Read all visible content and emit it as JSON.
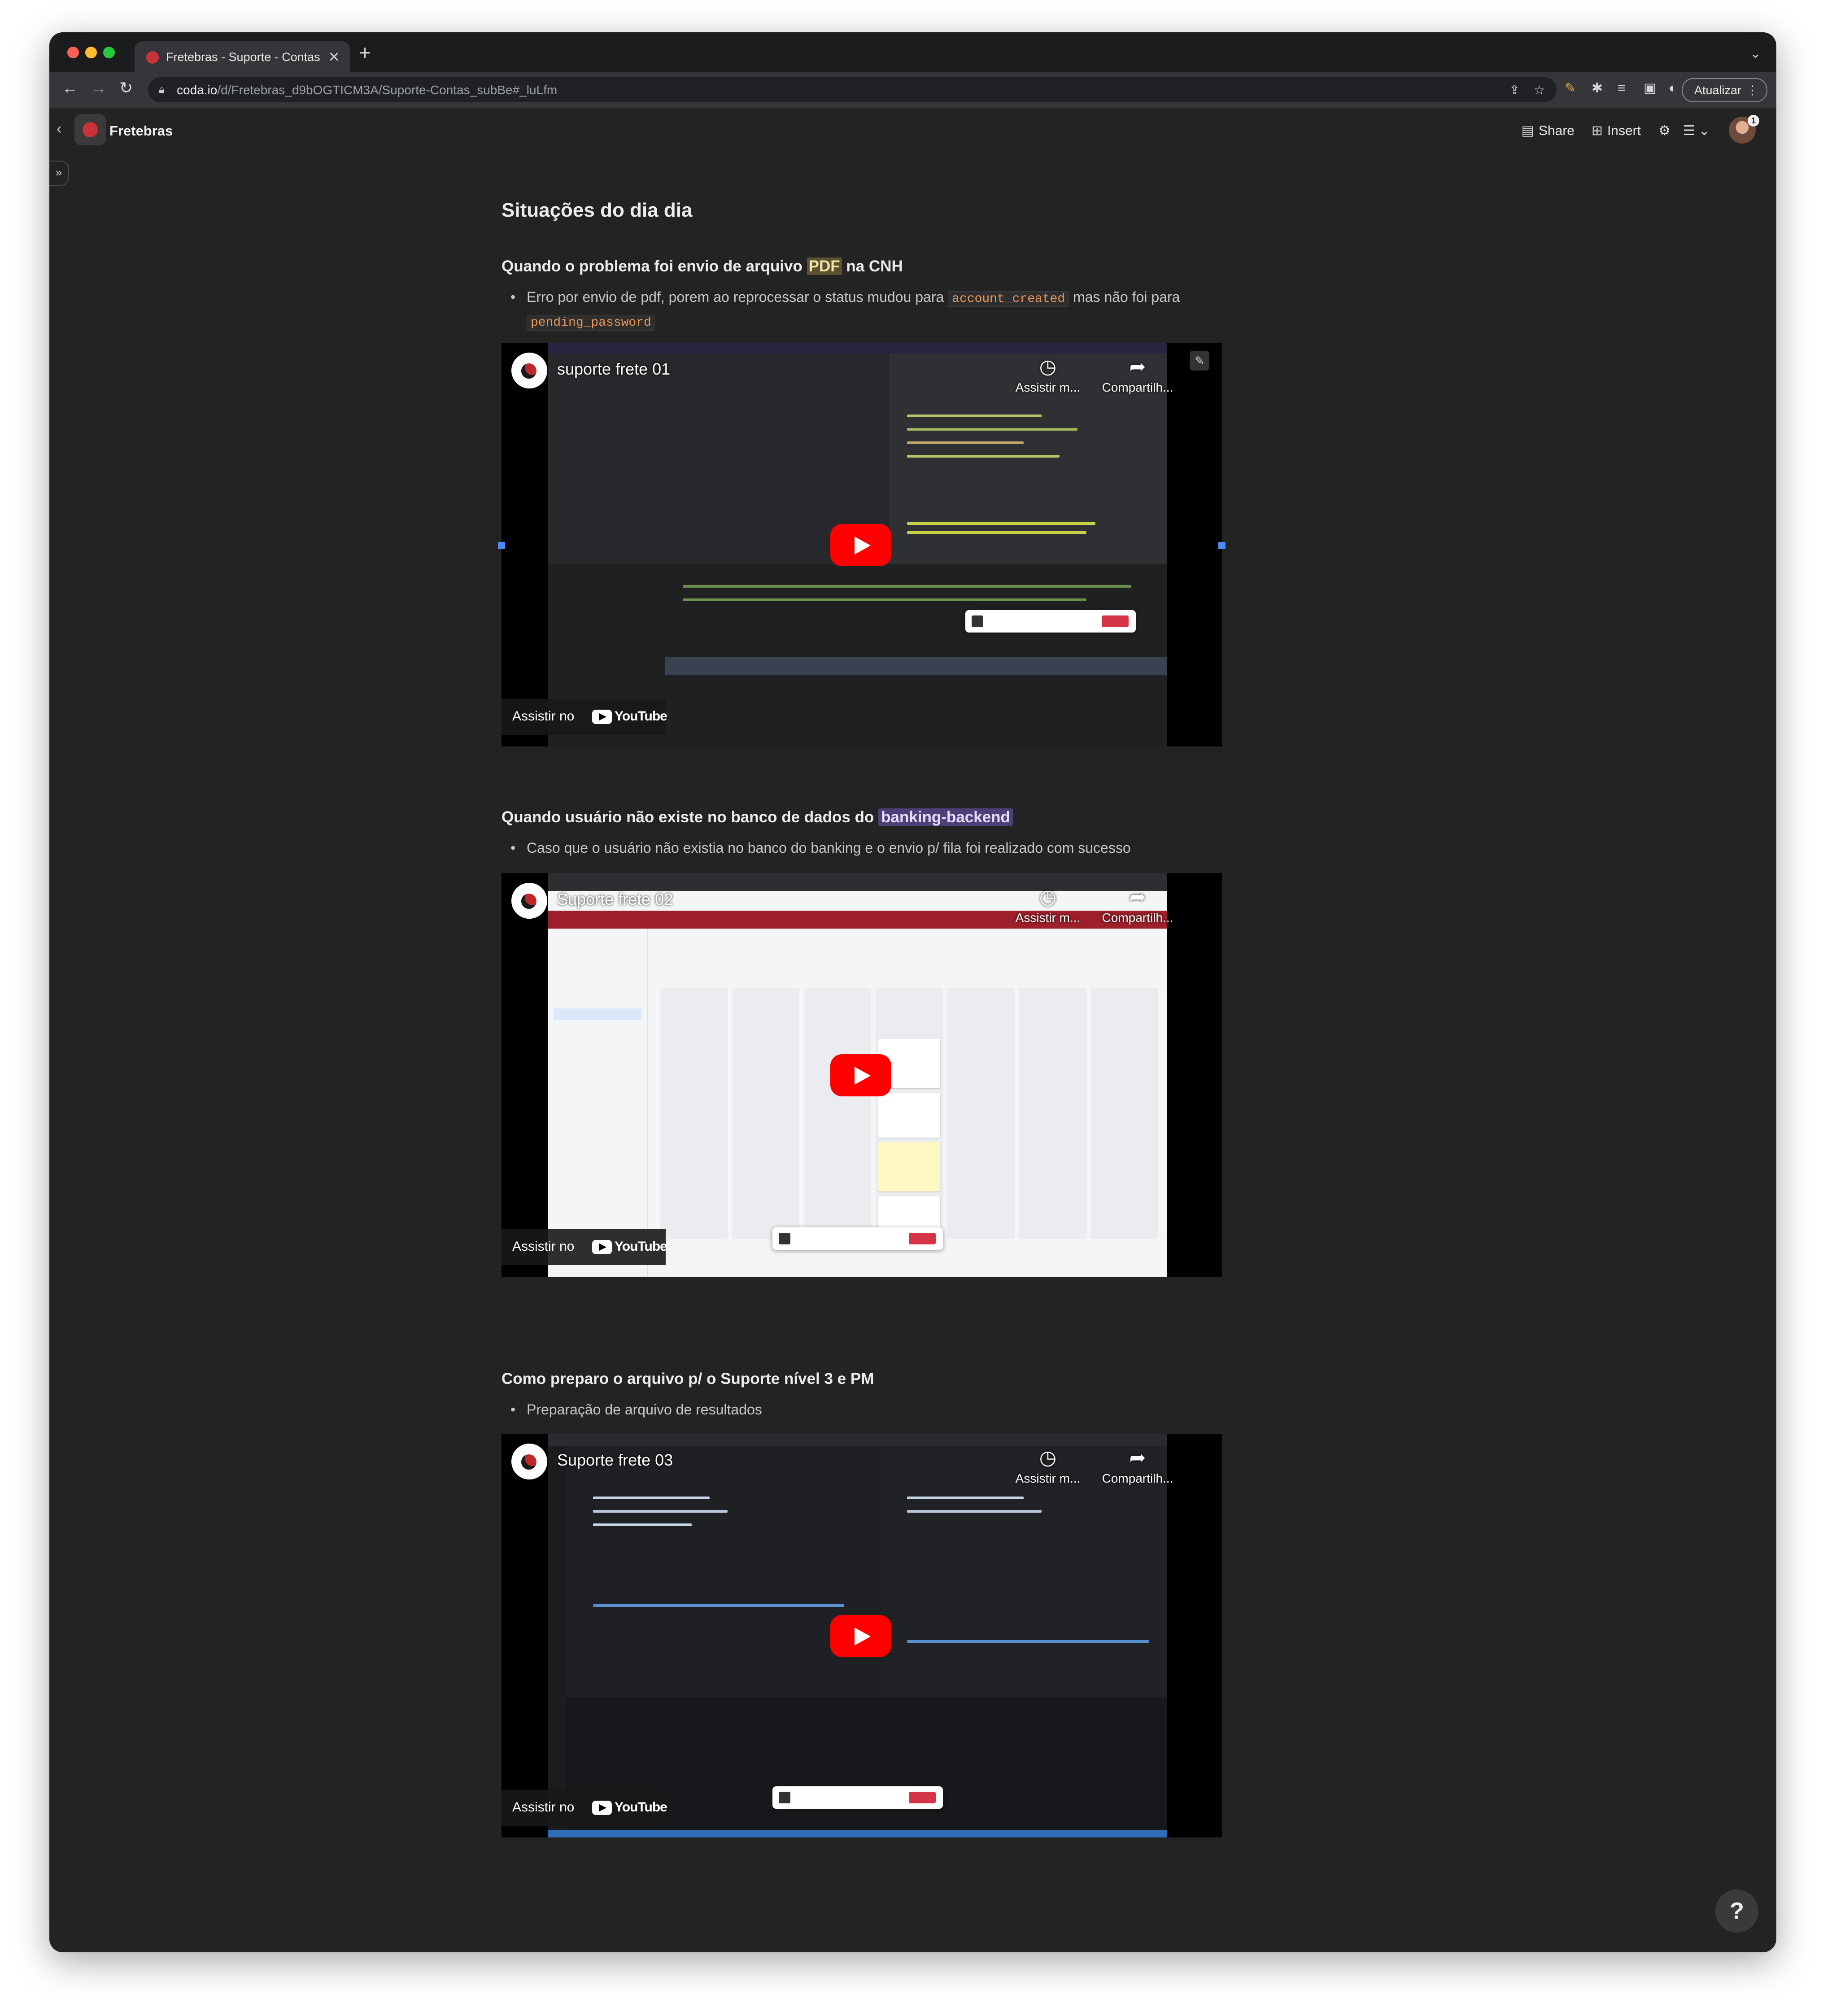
{
  "browser": {
    "tab_title": "Fretebras - Suporte - Contas",
    "tab_close": "✕",
    "new_tab": "+",
    "url_host": "coda.io",
    "url_path": "/d/Fretebras_d9bOGTICM3A/Suporte-Contas_subBe#_luLfm",
    "update_button": "Atualizar"
  },
  "coda": {
    "doc_title": "Fretebras",
    "share_label": "Share",
    "insert_label": "Insert",
    "notification_count": "1"
  },
  "content": {
    "page_heading": "Situações do dia dia",
    "sections": [
      {
        "heading_pre": "Quando o problema foi envio de arquivo ",
        "heading_hl": "PDF",
        "heading_post": " na CNH",
        "bullet_pre": "Erro por envio de pdf, porem ao reprocessar o status mudou para ",
        "bullet_code1": "account_created",
        "bullet_mid": " mas não foi para",
        "bullet_code2": "pending_password",
        "video": {
          "title": "suporte frete 01"
        }
      },
      {
        "heading_pre": "Quando usuário não existe no banco de dados do ",
        "heading_hl": "banking-backend",
        "bullet": "Caso que o usuário não existia no banco do banking e o envio p/ fila foi realizado com sucesso",
        "video": {
          "title": "Suporte frete 02"
        }
      },
      {
        "heading": "Como preparo o arquivo p/ o Suporte nível 3 e PM",
        "bullet": "Preparação de arquivo de resultados",
        "video": {
          "title": "Suporte frete 03"
        }
      }
    ]
  },
  "youtube": {
    "watch_later": "Assistir m...",
    "share": "Compartilh...",
    "watch_on": "Assistir no",
    "wordmark": "YouTube"
  },
  "help_label": "?",
  "colors": {
    "window_bg": "#232323",
    "youtube_red": "#ff0000",
    "pdf_highlight": "#5a5033",
    "banking_highlight": "#4d3f78",
    "code_text": "#e8975a"
  }
}
